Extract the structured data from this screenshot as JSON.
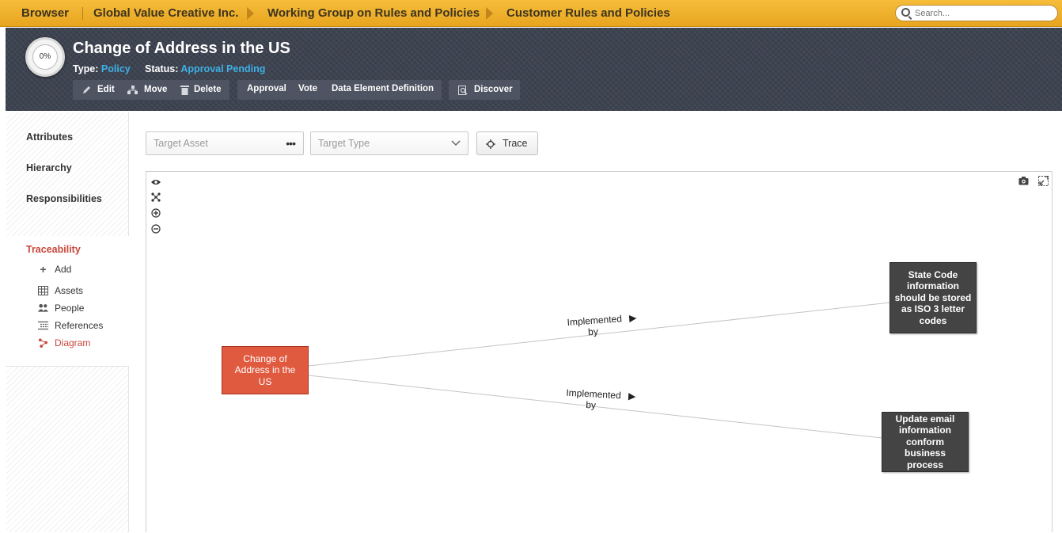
{
  "breadcrumb": {
    "home": "Browser",
    "items": [
      "Global Value Creative Inc.",
      "Working Group on Rules and Policies",
      "Customer Rules and Policies"
    ]
  },
  "search": {
    "placeholder": "Search..."
  },
  "asset": {
    "progress": "0%",
    "title": "Change of Address in the US",
    "type_label": "Type:",
    "type_value": "Policy",
    "status_label": "Status:",
    "status_value": "Approval Pending"
  },
  "actions": {
    "edit": "Edit",
    "move": "Move",
    "delete": "Delete",
    "approval": "Approval",
    "vote": "Vote",
    "data_element_definition": "Data Element Definition",
    "discover": "Discover"
  },
  "sidebar": {
    "items": [
      "Attributes",
      "Hierarchy",
      "Responsibilities"
    ],
    "traceability": {
      "heading": "Traceability",
      "sub_items": [
        {
          "label": "Add",
          "icon": "plus-icon"
        },
        {
          "label": "Assets",
          "icon": "table-icon"
        },
        {
          "label": "People",
          "icon": "people-icon"
        },
        {
          "label": "References",
          "icon": "list-icon"
        },
        {
          "label": "Diagram",
          "icon": "diagram-icon",
          "active": true
        }
      ]
    }
  },
  "controls": {
    "target_asset_placeholder": "Target Asset",
    "target_type_placeholder": "Target Type",
    "trace_label": "Trace"
  },
  "diagram": {
    "source_node": "Change of Address in the US",
    "target_nodes": [
      "State Code information should be stored as ISO 3 letter codes",
      "Update email information conform business process"
    ],
    "edge_label_line1": "Implemented",
    "edge_label_line2": "by",
    "edge_arrow": "▶"
  },
  "colors": {
    "topbar": "#f1b32f",
    "header": "#3d4350",
    "accent_blue": "#3fb0e6",
    "accent_red": "#c8473a",
    "source_node": "#e05a3f",
    "target_node": "#444444"
  }
}
